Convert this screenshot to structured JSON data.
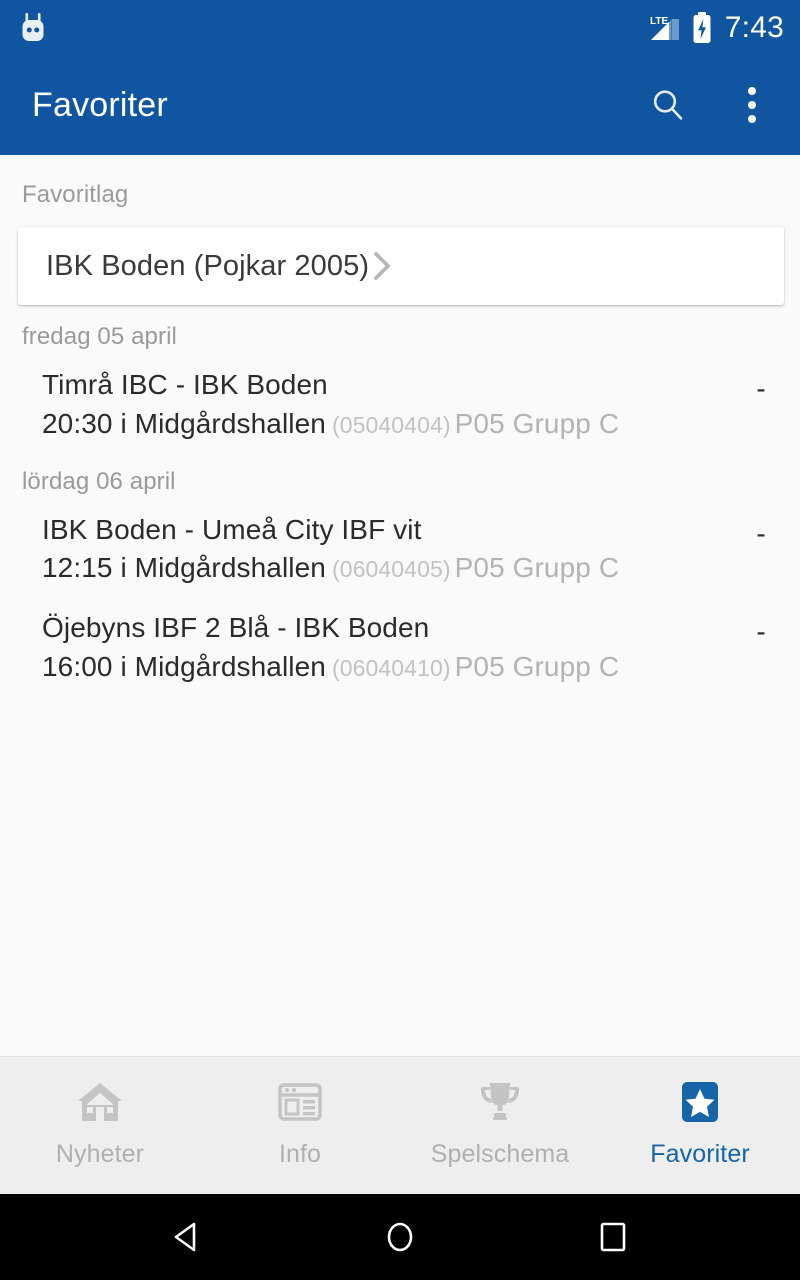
{
  "status_bar": {
    "os_icon": "cyanogenmod-cid-icon",
    "network_type": "LTE",
    "signal_icon": "signal-bars-icon",
    "battery_icon": "battery-charging-icon",
    "time": "7:43"
  },
  "app_bar": {
    "title": "Favoriter",
    "search_icon": "search-icon",
    "overflow_icon": "overflow-menu-icon"
  },
  "content": {
    "favorite_section_label": "Favoritlag",
    "favorite_team": {
      "name": "IBK Boden (Pojkar 2005)",
      "chevron_icon": "chevron-right-icon"
    },
    "date_groups": [
      {
        "date": "fredag 05 april",
        "matches": [
          {
            "teams": "Timrå IBC - IBK Boden",
            "time": "20:30",
            "venue": "i Midgårdshallen",
            "match_id": "(05040404)",
            "group": "P05 Grupp C",
            "score": "-"
          }
        ]
      },
      {
        "date": "lördag 06 april",
        "matches": [
          {
            "teams": "IBK Boden - Umeå City IBF vit",
            "time": "12:15",
            "venue": "i Midgårdshallen",
            "match_id": "(06040405)",
            "group": "P05 Grupp C",
            "score": "-"
          },
          {
            "teams": "Öjebyns IBF 2 Blå - IBK Boden",
            "time": "16:00",
            "venue": "i Midgårdshallen",
            "match_id": "(06040410)",
            "group": "P05 Grupp C",
            "score": "-"
          }
        ]
      }
    ]
  },
  "tab_bar": {
    "tabs": [
      {
        "label": "Nyheter",
        "icon": "home-icon",
        "active": false
      },
      {
        "label": "Info",
        "icon": "article-window-icon",
        "active": false
      },
      {
        "label": "Spelschema",
        "icon": "trophy-icon",
        "active": false
      },
      {
        "label": "Favoriter",
        "icon": "star-badge-icon",
        "active": true
      }
    ]
  },
  "nav_bar": {
    "back_icon": "back-triangle-icon",
    "home_icon": "home-circle-icon",
    "recents_icon": "recents-square-icon"
  },
  "colors": {
    "primary": "#0F559F",
    "accent": "#1565A8",
    "background": "#FAFAFA",
    "card": "#FFFFFF",
    "tab_bar": "#EEEEEE",
    "muted_text": "#9A9A9A",
    "body_text": "#2B2B2B"
  }
}
